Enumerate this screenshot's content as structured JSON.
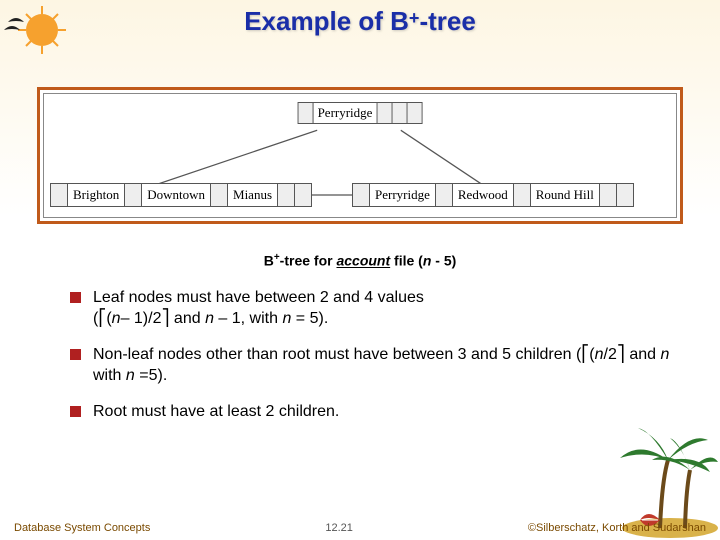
{
  "title_pre": "Example of B",
  "title_sup": "+",
  "title_post": "-tree",
  "diagram": {
    "root": {
      "label": "Perryridge"
    },
    "leaf1": [
      "Brighton",
      "Downtown",
      "Mianus"
    ],
    "leaf2": [
      "Perryridge",
      "Redwood",
      "Round Hill"
    ]
  },
  "caption": {
    "pre": "B",
    "sup": "+",
    "mid1": "-tree for ",
    "account": "account",
    "mid2": " file (",
    "n": "n",
    "post": " - 5)"
  },
  "bullets": [
    {
      "main": "Leaf nodes must have between 2 and 4 values",
      "sub_pre": "(⎡(",
      "sub_n1": "n",
      "sub_mid1": "– 1)/2⎤ and ",
      "sub_n2": "n",
      "sub_mid2": " – 1, with ",
      "sub_n3": "n",
      "sub_end": " = 5)."
    },
    {
      "main_pre": "Non-leaf nodes other than root must have between 3 and 5 children (⎡(",
      "main_n1": "n",
      "main_mid1": "/2⎤ and ",
      "main_n2": "n",
      "main_mid2": " with ",
      "main_n3": "n",
      "main_end": " =5)."
    },
    {
      "main": "Root must have at least 2 children."
    }
  ],
  "footer": {
    "left": "Database System Concepts",
    "mid": "12.21",
    "right": "©Silberschatz, Korth and Sudarshan"
  }
}
